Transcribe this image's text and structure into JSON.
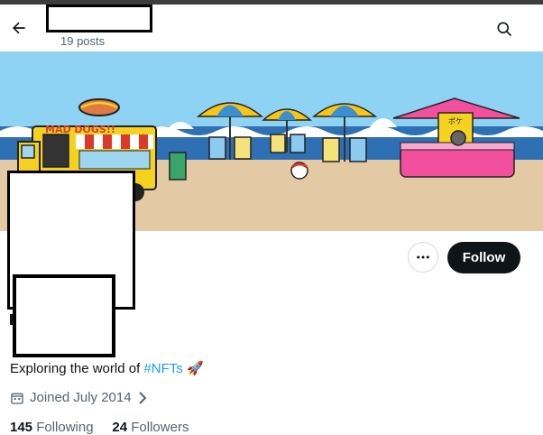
{
  "header": {
    "posts": "19 posts",
    "back_icon": "arrow-left-icon",
    "search_icon": "search-icon"
  },
  "banner": {
    "sign": "MAD DOGS!!",
    "booth_sign": "ポケ"
  },
  "actions": {
    "more_icon": "more-horizontal-icon",
    "follow_label": "Follow"
  },
  "profile": {
    "bio_text": "Exploring the world of ",
    "bio_tag": "#NFTs",
    "bio_emoji": "🚀",
    "joined": "Joined July 2014",
    "following_count": "145",
    "following_label": " Following",
    "followers_count": "24",
    "followers_label": " Followers"
  },
  "colors": {
    "follow_bg": "#0f1419",
    "link": "#1d9bf0",
    "muted": "#536471",
    "sky": "#8fd3f4",
    "sand": "#e3c9a4",
    "booth_pink": "#f2509e",
    "truck_yellow": "#f5d21f"
  }
}
